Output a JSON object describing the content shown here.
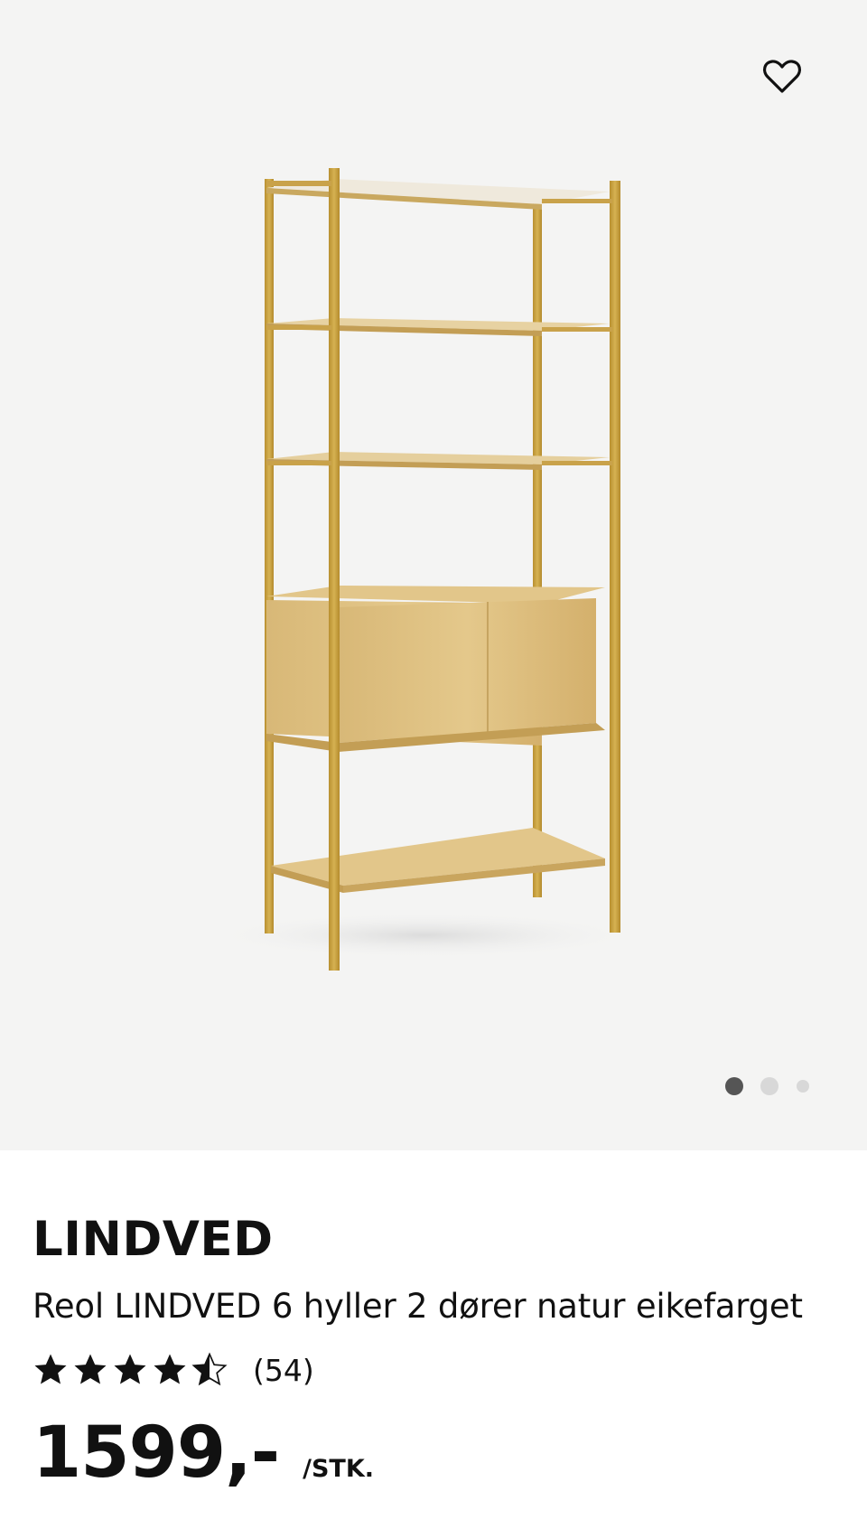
{
  "gallery": {
    "image_alt": "Reol LINDVED 6 hyller 2 dører natur eikefarget",
    "background": "#f4f4f3",
    "wood_color": "#d9b877",
    "frame_color": "#c9a24a",
    "active_slide": 1,
    "slide_count": 3,
    "favorite_icon": "heart-outline-icon"
  },
  "product": {
    "brand": "LINDVED",
    "title": "Reol LINDVED 6 hyller 2 dører natur eikefarget",
    "rating": 4.5,
    "rating_max": 5,
    "review_count": "(54)",
    "price": "1599,-",
    "unit": "/STK."
  }
}
